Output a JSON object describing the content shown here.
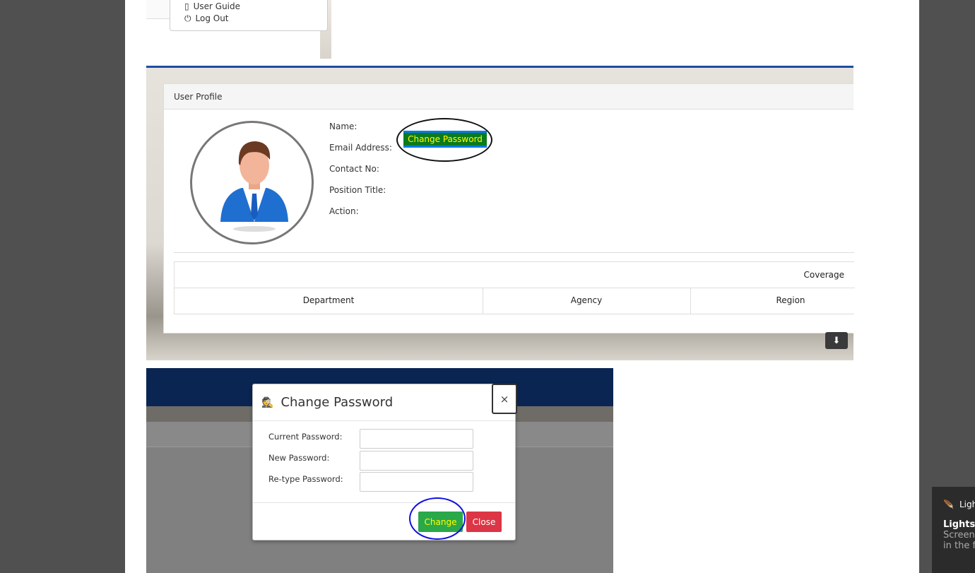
{
  "menu": {
    "items": [
      {
        "label": "User Guide",
        "icon": "pdf-icon"
      },
      {
        "label": "Log Out",
        "icon": "power-icon"
      }
    ]
  },
  "profile": {
    "title": "User Profile",
    "fields": [
      "Name:",
      "Email Address:",
      "Contact No:",
      "Position Title:",
      "Action:"
    ],
    "change_password_label": "Change Password",
    "table": {
      "group_header": "Coverage",
      "columns": [
        "Department",
        "Agency",
        "Region"
      ]
    }
  },
  "modal": {
    "title": "Change Password",
    "icon": "spy-icon",
    "close_symbol": "×",
    "fields": [
      {
        "label": "Current Password:",
        "value": ""
      },
      {
        "label": "New Password:",
        "value": ""
      },
      {
        "label": "Re-type Password:",
        "value": ""
      }
    ],
    "change_label": "Change",
    "close_label": "Close"
  },
  "toast": {
    "app": "Lightshot",
    "title": "Lightshot",
    "line1": "Screenshot",
    "line2": "in the f"
  },
  "colors": {
    "navy": "#0a2552",
    "accent": "#1a4fa0",
    "success": "#2aa84a",
    "danger": "#dc3545"
  }
}
